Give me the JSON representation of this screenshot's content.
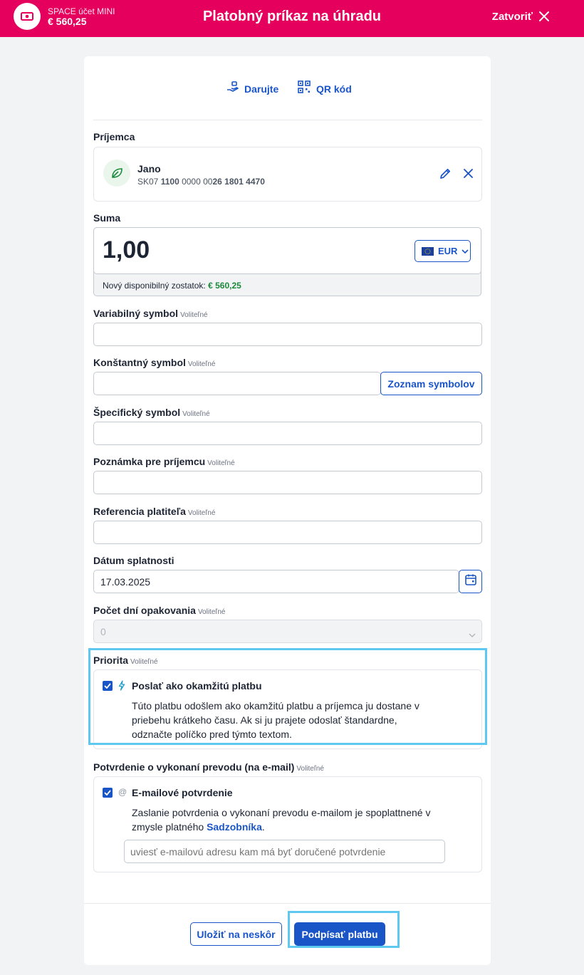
{
  "header": {
    "account_name": "SPACE účet MINI",
    "account_balance": "€ 560,25",
    "title": "Platobný príkaz na úhradu",
    "close_label": "Zatvoriť"
  },
  "top_links": {
    "donate": "Darujte",
    "qr": "QR kód"
  },
  "recipient": {
    "label": "Príjemca",
    "name": "Jano",
    "iban_parts": [
      "SK07 ",
      "1100",
      " 0000 00",
      "26 1801 4470"
    ]
  },
  "amount": {
    "label": "Suma",
    "value": "1,00",
    "currency": "EUR",
    "balance_label": "Nový disponibilný zostatok:",
    "balance_value": "€ 560,25"
  },
  "optional_tag": "Voliteľné",
  "fields": {
    "variable_symbol": {
      "label": "Variabilný symbol",
      "value": ""
    },
    "constant_symbol": {
      "label": "Konštantný symbol",
      "value": "",
      "button": "Zoznam symbolov"
    },
    "specific_symbol": {
      "label": "Špecifický symbol",
      "value": ""
    },
    "note": {
      "label": "Poznámka pre príjemcu",
      "value": ""
    },
    "payer_reference": {
      "label": "Referencia platiteľa",
      "value": ""
    },
    "due_date": {
      "label": "Dátum splatnosti",
      "value": "17.03.2025"
    },
    "repeat_days": {
      "label": "Počet dní opakovania",
      "value": "0"
    }
  },
  "priority": {
    "label": "Priorita",
    "checkbox_label": "Poslať ako okamžitú platbu",
    "checked": true,
    "desc_lines": [
      "Túto platbu odošlem ako okamžitú platbu a príjemca ju dostane v",
      "priebehu krátkeho času. Ak si ju prajete odoslať štandardne,",
      "odznačte políčko pred týmto textom."
    ]
  },
  "confirmation": {
    "label": "Potvrdenie o vykonaní prevodu (na e-mail)",
    "checkbox_label": "E-mailové potvrdenie",
    "checked": true,
    "desc_line1": "Zaslanie potvrdenia o vykonaní prevodu e-mailom je spoplattnené v",
    "desc_line2_prefix": "zmysle platného ",
    "desc_link": "Sadzobníka",
    "desc_suffix": ".",
    "email_placeholder": "uviesť e-mailovú adresu kam má byť doručené potvrdenie"
  },
  "actions": {
    "save_later": "Uložiť na neskôr",
    "sign": "Podpísať platbu"
  },
  "colors": {
    "brand": "#e5005e",
    "primary": "#1a55c7",
    "highlight": "#5fc8f0",
    "positive": "#1a8a3a"
  }
}
